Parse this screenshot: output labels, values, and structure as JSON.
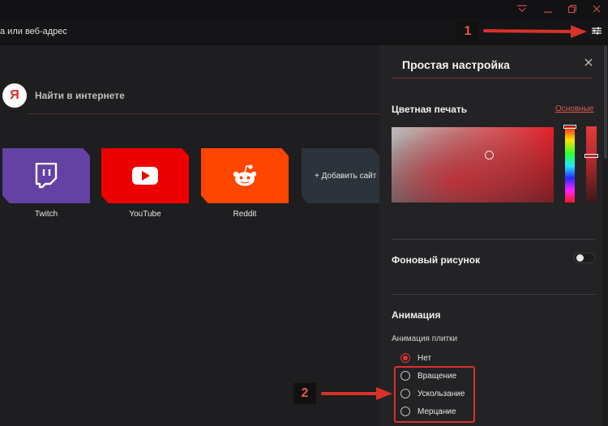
{
  "window": {
    "controls": [
      "easy-setup-icon",
      "minimize-icon",
      "restore-icon",
      "close-icon"
    ]
  },
  "address_bar": {
    "text": "а или веб-адрес"
  },
  "search": {
    "logo_letter": "Я",
    "placeholder": "Найти в интернете"
  },
  "speed_dial": {
    "tiles": [
      {
        "label": "Twitch",
        "color": "#6441a5",
        "icon": "twitch-icon"
      },
      {
        "label": "YouTube",
        "color": "#ef0000",
        "icon": "youtube-icon"
      },
      {
        "label": "Reddit",
        "color": "#ff4500",
        "icon": "reddit-icon"
      }
    ],
    "add_label": "+ Добавить сайт"
  },
  "panel": {
    "title": "Простая настройка",
    "color_section": {
      "title": "Цветная печать",
      "link": "Основные"
    },
    "wallpaper_section": {
      "title": "Фоновый рисунок",
      "enabled": false
    },
    "animation_section": {
      "title": "Анимация",
      "subtitle": "Анимация плитки",
      "options": [
        {
          "label": "Нет",
          "checked": true
        },
        {
          "label": "Вращение",
          "checked": false
        },
        {
          "label": "Ускользание",
          "checked": false
        },
        {
          "label": "Мерцание",
          "checked": false
        }
      ]
    }
  },
  "annotations": {
    "badge_1": "1",
    "badge_2": "2",
    "accent_color": "#d8322a"
  }
}
